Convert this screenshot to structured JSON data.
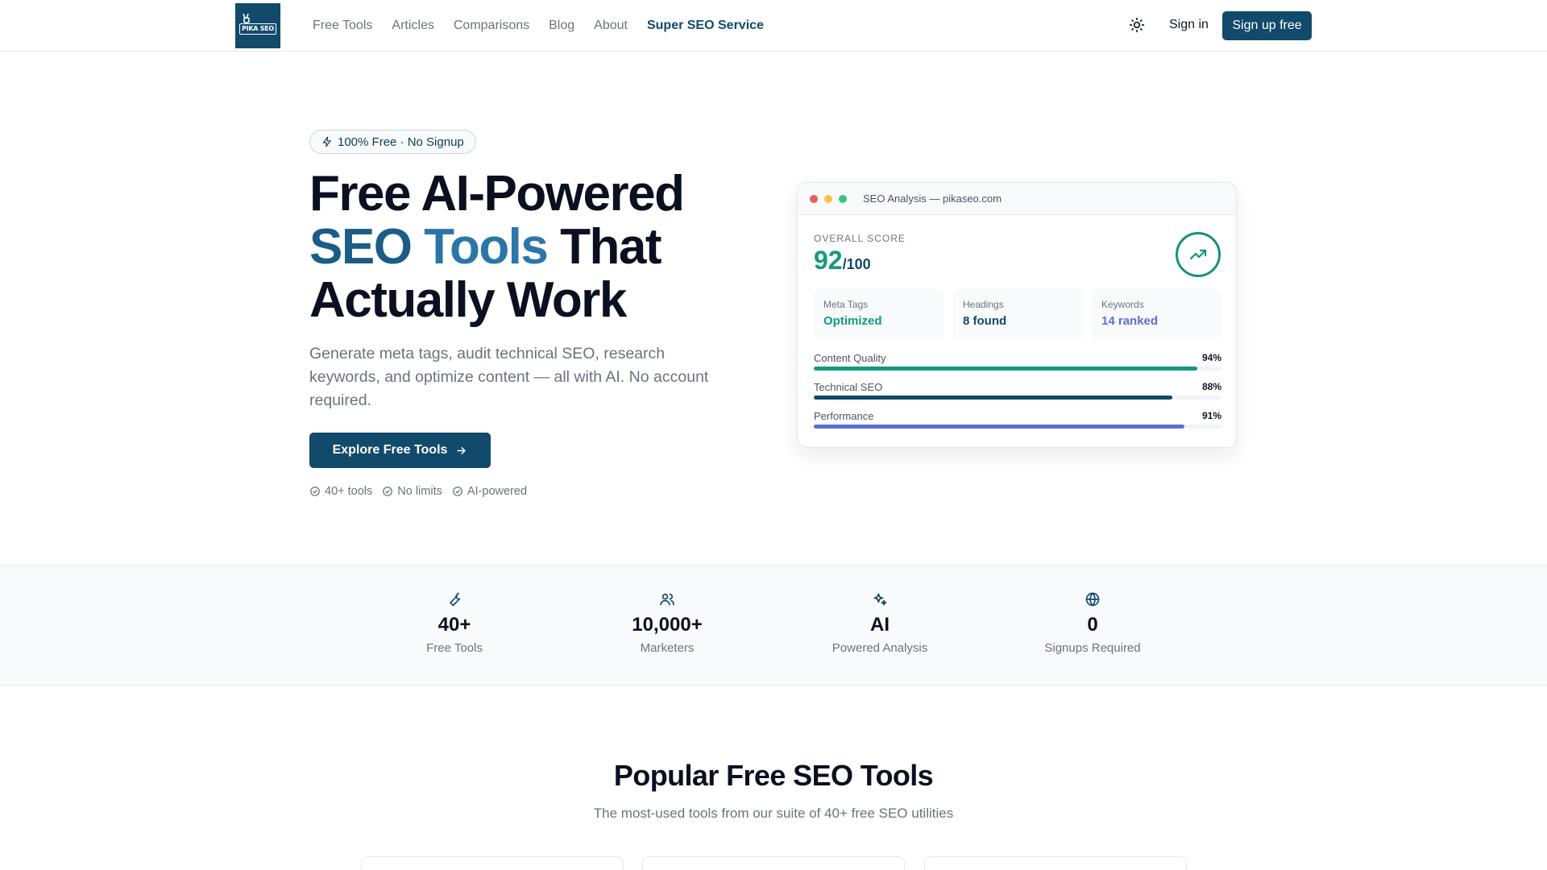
{
  "header": {
    "logo_text": "PIKA SEO",
    "nav": [
      "Free Tools",
      "Articles",
      "Comparisons",
      "Blog",
      "About",
      "Super SEO Service"
    ],
    "signin": "Sign in",
    "signup": "Sign up free"
  },
  "hero": {
    "badge": "100% Free · No Signup",
    "title_line1": "Free AI-Powered",
    "title_accent1": "SEO",
    "title_accent2": "Tools",
    "title_line2_rest": "That",
    "title_line3": "Actually Work",
    "subtitle": "Generate meta tags, audit technical SEO, research keywords, and optimize content — all with AI. No account required.",
    "cta": "Explore Free Tools",
    "checks": [
      "40+ tools",
      "No limits",
      "AI-powered"
    ]
  },
  "analysis_card": {
    "window_title": "SEO Analysis — pikaseo.com",
    "score_label": "OVERALL SCORE",
    "score": "92",
    "score_max": "/100",
    "metrics": [
      {
        "label": "Meta Tags",
        "value": "Optimized",
        "color": "#139a80"
      },
      {
        "label": "Headings",
        "value": "8 found",
        "color": "#124a6c"
      },
      {
        "label": "Keywords",
        "value": "14 ranked",
        "color": "#5b6fd0"
      }
    ],
    "bars": [
      {
        "label": "Content Quality",
        "pct_text": "94%",
        "value": 0.94,
        "color": "#139a80"
      },
      {
        "label": "Technical SEO",
        "pct_text": "88%",
        "value": 0.88,
        "color": "#124a6c"
      },
      {
        "label": "Performance",
        "pct_text": "91%",
        "value": 0.91,
        "color": "#5b6fd0"
      }
    ]
  },
  "stats": [
    {
      "icon": "wrench-icon",
      "value": "40+",
      "label": "Free Tools"
    },
    {
      "icon": "users-icon",
      "value": "10,000+",
      "label": "Marketers"
    },
    {
      "icon": "sparkles-icon",
      "value": "AI",
      "label": "Powered Analysis"
    },
    {
      "icon": "globe-icon",
      "value": "0",
      "label": "Signups Required"
    }
  ],
  "popular": {
    "title": "Popular Free SEO Tools",
    "subtitle": "The most-used tools from our suite of 40+ free SEO utilities"
  },
  "colors": {
    "brand": "#124a6c",
    "accent_green": "#139a80",
    "accent_indigo": "#5b6fd0"
  }
}
